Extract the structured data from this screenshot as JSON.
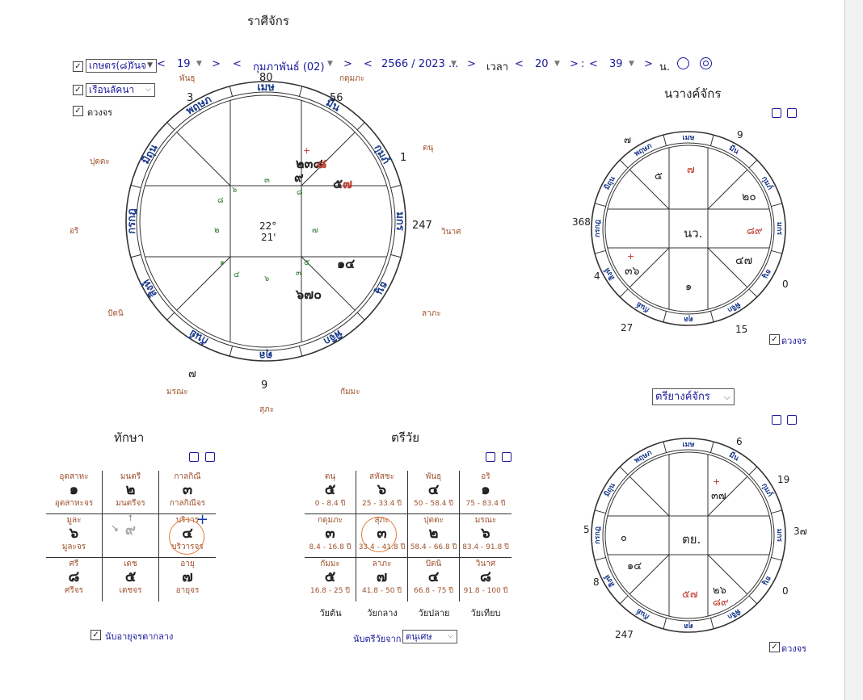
{
  "header": {
    "title": "ราศีจักร"
  },
  "controls": {
    "check1": {
      "label": "เกษตร(๘)",
      "checked": true
    },
    "check2": {
      "label": "เรือนลัคนา",
      "checked": true
    },
    "check3": {
      "label": "ดวงจร",
      "checked": true
    },
    "weekday": "วันจ",
    "day": "19",
    "month": "กุมภาพันธ์ (02)",
    "year": "2566 / 2023 ...",
    "time_label": "เวลา",
    "hour": "20",
    "minute": "39",
    "unit": "น."
  },
  "main_chart": {
    "signs": [
      "เมษ",
      "มีน",
      "กุมภ์",
      "มกร",
      "ธนู",
      "พิจิก",
      "ตุล",
      "กันย์",
      "สิงห์",
      "กรกฎ",
      "มิถุน",
      "พฤษภ"
    ],
    "center_top": "22°",
    "center_bottom": "21'",
    "outer_numbers": {
      "top": "80",
      "top_right": "56",
      "right_top": "1",
      "right": "247",
      "top_left": "3",
      "bottom": "9",
      "bottom_left": "๗"
    },
    "outer_labels": {
      "pantu": "พันธุ",
      "kudumpa": "กดุมภะ",
      "tanu": "ตนุ",
      "putta": "ปุตตะ",
      "ari": "อริ",
      "winat": "วินาศ",
      "pattani": "ปัตนิ",
      "lapa": "ลาภะ",
      "morana": "มรณะ",
      "kammat": "กัมมะ",
      "supa": "สุภะ"
    },
    "house_planets": {
      "h_kumph": "๒๓๘",
      "h_kumph2": "๙",
      "h_kumph_red": "๘",
      "h_mkr_right": "๕",
      "h_mkr_right_red": "๗",
      "h_dhanu": "๑๔",
      "h_pijik": "๖๗๐",
      "plus": "+"
    },
    "house_nums": {
      "n1": "๓",
      "n2": "๘",
      "n3": "๖",
      "n4": "๘",
      "n5": "๒",
      "n6": "๗",
      "n7": "๑",
      "n8": "๔",
      "n9": "๖",
      "n10": "๕",
      "n11": "๓"
    }
  },
  "navang": {
    "title": "นวางค์จักร",
    "signs": [
      "เมษ",
      "มีน",
      "กุมภ์",
      "มกร",
      "ธนู",
      "พิจิก",
      "ตุล",
      "กันย์",
      "สิงห์",
      "กรกฎ",
      "มิถุน",
      "พฤษภ"
    ],
    "center": "นว.",
    "outer": {
      "tl": "๗",
      "tr": "9",
      "l": "368",
      "bl": "4",
      "br": "0",
      "b1": "27",
      "b2": "15"
    },
    "cells": {
      "c_top": "๗",
      "c_top_left": "๕",
      "c_right_top": "๒๐",
      "c_right": "๘๙",
      "c_right_bot": "๔๗",
      "c_left_bot": "๓๖",
      "c_bot": "๑",
      "plus": "+"
    },
    "check_label": "ดวงจร"
  },
  "triyang": {
    "select": "ตรียางค์จักร",
    "signs": [
      "เมษ",
      "มีน",
      "กุมภ์",
      "มกร",
      "ธนู",
      "พิจิก",
      "ตุล",
      "กันย์",
      "สิงห์",
      "กรกฎ",
      "มิถุน",
      "พฤษภ"
    ],
    "center": "ตย.",
    "outer": {
      "t": "6",
      "tr": "19",
      "r": "3๗",
      "l": "5",
      "bl": "8",
      "br": "0",
      "b": "247"
    },
    "cells": {
      "c_rt": "๓๗",
      "c_left": "๐",
      "c_lb": "๑๔",
      "c_b": "๕๗",
      "c_rb1": "๒๖",
      "c_rb2": "๘๙",
      "plus": "+"
    },
    "check_label": "ดวงจร"
  },
  "taksa": {
    "title": "ทักษา",
    "cells": [
      {
        "top": "อุตสาหะ",
        "num": "๑",
        "bot": "อุตสาหะจร"
      },
      {
        "top": "มนตรี",
        "num": "๒",
        "bot": "มนตรีจร"
      },
      {
        "top": "กาลกิณี",
        "num": "๓",
        "bot": "กาลกิณีจร"
      },
      {
        "top": "มูละ",
        "num": "๖",
        "bot": "มูละจร"
      },
      {
        "top": "↑",
        "num": "๙",
        "bot": ""
      },
      {
        "top": "บริวาร",
        "num": "๔",
        "bot": "บริวารจร"
      },
      {
        "top": "ศรี",
        "num": "๘",
        "bot": "ศรีจร"
      },
      {
        "top": "เดช",
        "num": "๕",
        "bot": "เดชจร"
      },
      {
        "top": "อายุ",
        "num": "๗",
        "bot": "อายุจร"
      }
    ],
    "arrow": "↘",
    "check_label": "นับอายุจรตากลาง"
  },
  "triwai": {
    "title": "ตรีวัย",
    "cells": [
      {
        "top": "ตนุ",
        "num": "๕",
        "bot": "0 - 8.4 ปี"
      },
      {
        "top": "สหัสชะ",
        "num": "๖",
        "bot": "25 - 33.4 ปี"
      },
      {
        "top": "พันธุ",
        "num": "๔",
        "bot": "50 - 58.4 ปี"
      },
      {
        "top": "อริ",
        "num": "๑",
        "bot": "75 - 83.4 ปี"
      },
      {
        "top": "กดุมภะ",
        "num": "๓",
        "bot": "8.4 - 16.8 ปี"
      },
      {
        "top": "สุภะ",
        "num": "๓",
        "bot": "33.4 - 41.8 ปี"
      },
      {
        "top": "ปุตตะ",
        "num": "๒",
        "bot": "58.4 - 66.8 ปี"
      },
      {
        "top": "มรณะ",
        "num": "๖",
        "bot": "83.4 - 91.8 ปี"
      },
      {
        "top": "กัมมะ",
        "num": "๕",
        "bot": "16.8 - 25 ปี"
      },
      {
        "top": "ลาภะ",
        "num": "๗",
        "bot": "41.8 - 50 ปี"
      },
      {
        "top": "ปัตนิ",
        "num": "๔",
        "bot": "66.8 - 75 ปี"
      },
      {
        "top": "วินาศ",
        "num": "๘",
        "bot": "91.8 - 100 ปี"
      }
    ],
    "ages": [
      "วัยต้น",
      "วัยกลาง",
      "วัยปลาย",
      "วัยเทียบ"
    ],
    "count_label": "นับตรีวัยจาก",
    "count_select": "ตนุเศษ"
  }
}
